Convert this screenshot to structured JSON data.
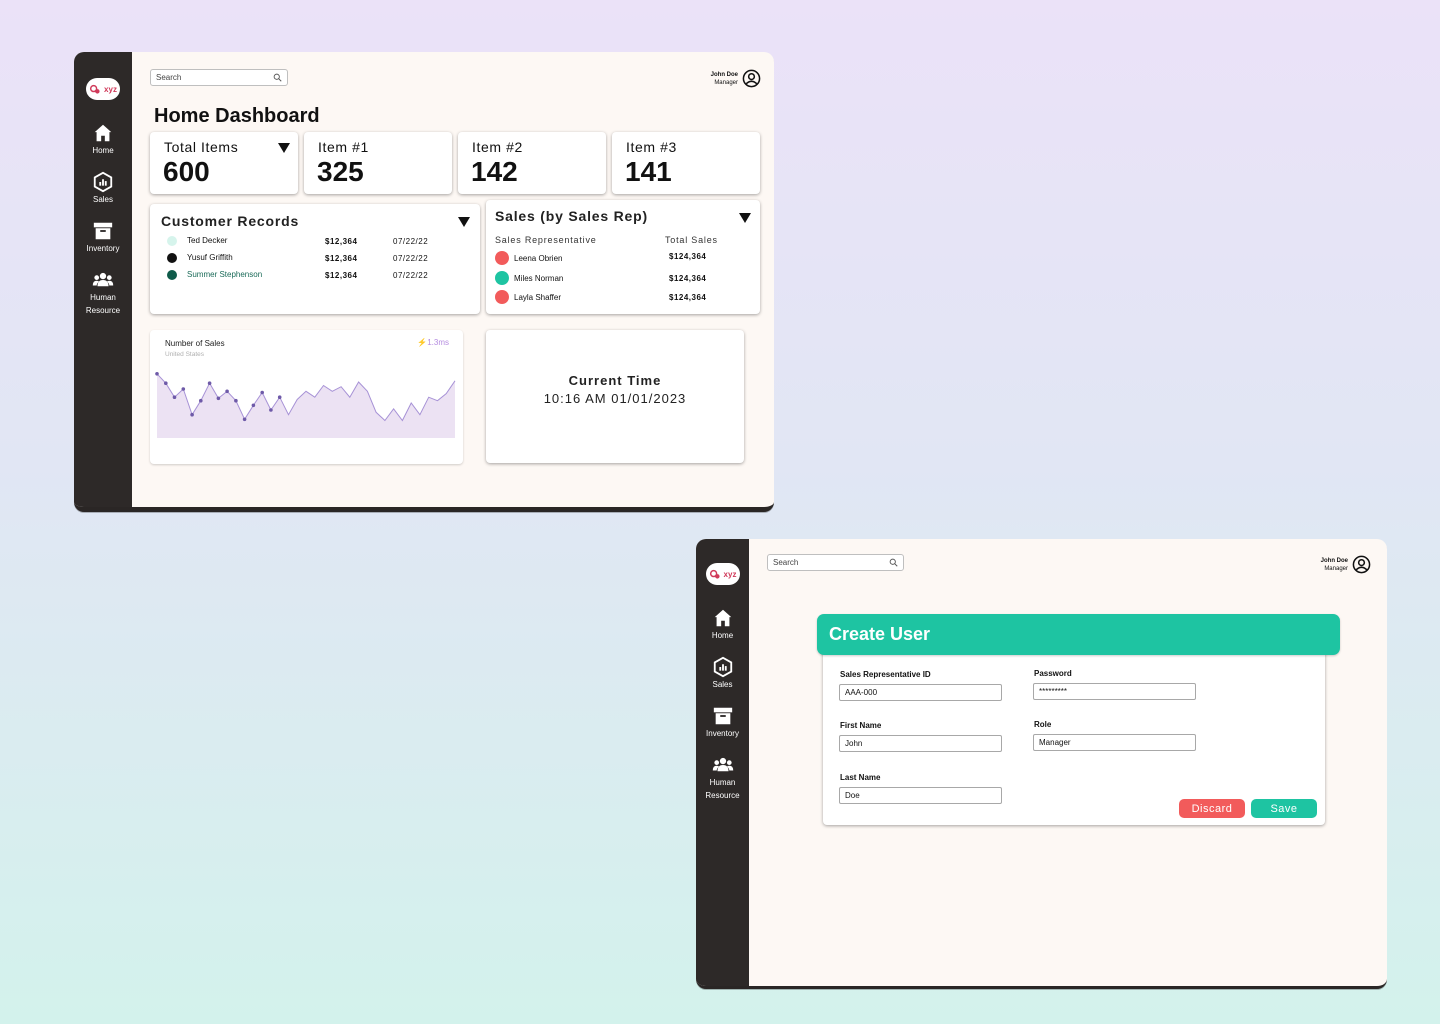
{
  "colors": {
    "sidebar": "#2d2928",
    "teal": "#1ec4a2",
    "red": "#f25b5b",
    "brand": "#d03a5a",
    "chart_line": "#a792d6",
    "chart_fill": "#ece2f3"
  },
  "brand": {
    "logo_text": "xyz"
  },
  "sidebar": {
    "items": [
      {
        "label": "Home",
        "icon": "home-icon"
      },
      {
        "label": "Sales",
        "icon": "sales-chart-icon"
      },
      {
        "label": "Inventory",
        "icon": "archive-box-icon"
      },
      {
        "label_line1": "Human",
        "label_line2": "Resource",
        "icon": "people-icon"
      }
    ]
  },
  "header": {
    "search_placeholder": "Search",
    "user_name": "John Doe",
    "user_role": "Manager"
  },
  "dashboard": {
    "title": "Home Dashboard",
    "stats": [
      {
        "label": "Total Items",
        "value": "600"
      },
      {
        "label": "Item #1",
        "value": "325"
      },
      {
        "label": "Item #2",
        "value": "142"
      },
      {
        "label": "Item #3",
        "value": "141"
      }
    ],
    "customer_records": {
      "title": "Customer Records",
      "rows": [
        {
          "name": "Ted Decker",
          "amount": "$12,364",
          "date": "07/22/22",
          "dot_color": "#d6f4ec",
          "name_color": "#111111"
        },
        {
          "name": "Yusuf Griffith",
          "amount": "$12,364",
          "date": "07/22/22",
          "dot_color": "#111111",
          "name_color": "#111111"
        },
        {
          "name": "Summer Stephenson",
          "amount": "$12,364",
          "date": "07/22/22",
          "dot_color": "#0f5b4a",
          "name_color": "#1b6b59"
        }
      ]
    },
    "sales_by_rep": {
      "title": "Sales (by Sales Rep)",
      "col_rep": "Sales Representative",
      "col_total": "Total Sales",
      "rows": [
        {
          "name": "Leena Obrien",
          "total": "$124,364",
          "dot_color": "#f25b5b"
        },
        {
          "name": "Miles Norman",
          "total": "$124,364",
          "dot_color": "#1ec4a2"
        },
        {
          "name": "Layla Shaffer",
          "total": "$124,364",
          "dot_color": "#f25b5b"
        }
      ]
    },
    "sales_chart": {
      "title": "Number of Sales",
      "subtitle": "United States",
      "badge": "⚡1.3ms"
    },
    "current_time": {
      "title": "Current Time",
      "value": "10:16 AM 01/01/2023"
    }
  },
  "chart_data": {
    "type": "area",
    "title": "Number of Sales",
    "subtitle": "United States",
    "x": [
      0,
      1,
      2,
      3,
      4,
      5,
      6,
      7,
      8,
      9,
      10,
      11,
      12,
      13,
      14,
      15,
      16,
      17,
      18,
      19,
      20,
      21,
      22,
      23,
      24,
      25,
      26,
      27,
      28,
      29,
      30,
      31,
      32,
      33,
      34
    ],
    "values": [
      55,
      47,
      35,
      42,
      20,
      32,
      47,
      34,
      40,
      32,
      16,
      28,
      39,
      24,
      35,
      20,
      33,
      40,
      35,
      45,
      40,
      44,
      35,
      48,
      40,
      22,
      15,
      25,
      15,
      30,
      20,
      35,
      32,
      38,
      49
    ],
    "marked_points": 15,
    "xlabel": "",
    "ylabel": "",
    "ylim": [
      0,
      60
    ],
    "grid": false
  },
  "create_user": {
    "title": "Create User",
    "fields": {
      "rep_id": {
        "label": "Sales Representative ID",
        "value": "AAA-000"
      },
      "password": {
        "label": "Password",
        "value": "*********"
      },
      "first_name": {
        "label": "First Name",
        "value": "John"
      },
      "role": {
        "label": "Role",
        "value": "Manager"
      },
      "last_name": {
        "label": "Last Name",
        "value": "Doe"
      }
    },
    "discard_label": "Discard",
    "save_label": "Save"
  }
}
